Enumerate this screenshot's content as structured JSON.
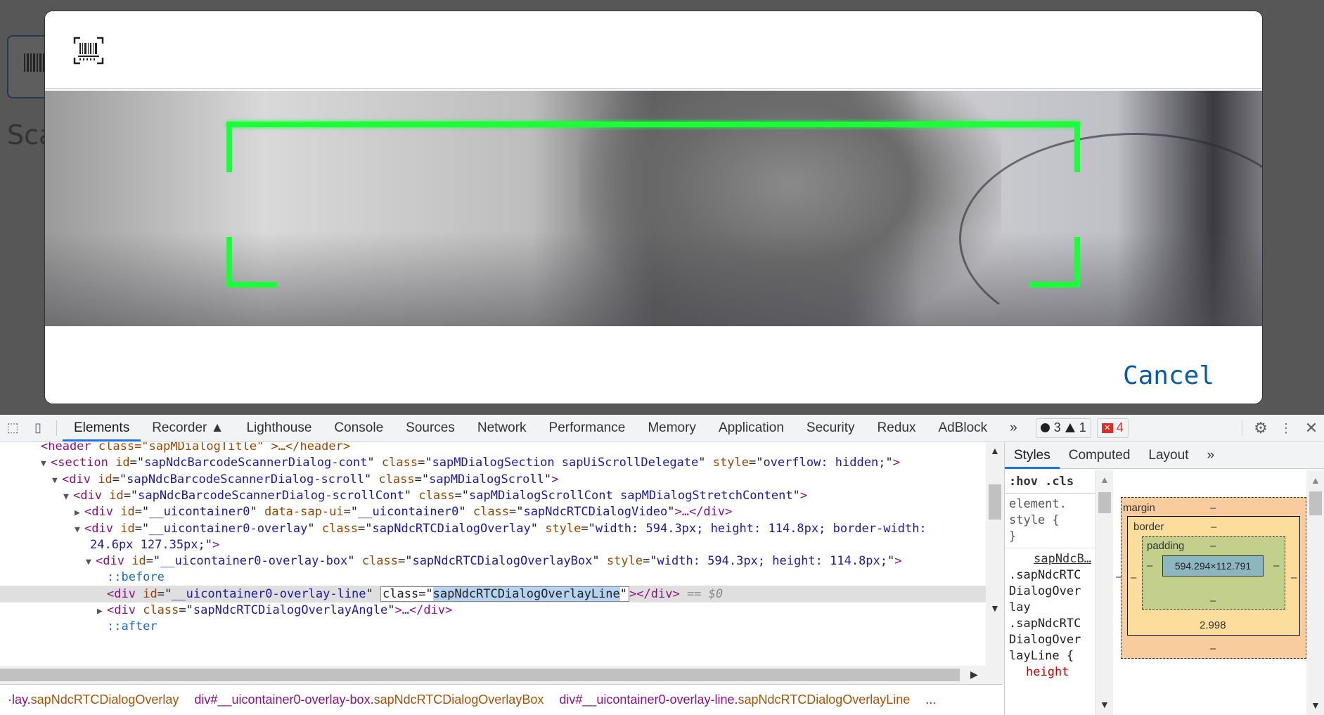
{
  "page": {
    "background_text": "Sca"
  },
  "dialog": {
    "cancel_label": "Cancel",
    "scan_icon": "barcode-scan-icon"
  },
  "devtools": {
    "tabs": [
      "Elements",
      "Recorder",
      "Lighthouse",
      "Console",
      "Sources",
      "Network",
      "Performance",
      "Memory",
      "Application",
      "Security",
      "Redux",
      "AdBlock"
    ],
    "more_tabs": "»",
    "errors_count": "3",
    "warnings_count": "1",
    "issues_count": "4",
    "elements": {
      "lines": [
        {
          "indent": 58,
          "open": "<",
          "tag": "header",
          "rest": " class=\"sapMDialogTitle\" >…</header>"
        },
        {
          "indent": 58,
          "twisty": "▼",
          "tag": "section",
          "attrs": [
            [
              "id",
              "sapNdcBarcodeScannerDialog-cont"
            ],
            [
              "class",
              "sapMDialogSection sapUiScrollDelegate"
            ],
            [
              "style",
              "overflow: hidden;"
            ]
          ],
          "close": ">"
        },
        {
          "indent": 74,
          "twisty": "▼",
          "tag": "div",
          "attrs": [
            [
              "id",
              "sapNdcBarcodeScannerDialog-scroll"
            ],
            [
              "class",
              "sapMDialogScroll"
            ]
          ],
          "close": ">"
        },
        {
          "indent": 90,
          "twisty": "▼",
          "tag": "div",
          "attrs": [
            [
              "id",
              "sapNdcBarcodeScannerDialog-scrollCont"
            ],
            [
              "class",
              "sapMDialogScrollCont sapMDialogStretchContent"
            ]
          ],
          "close": ">"
        },
        {
          "indent": 106,
          "twisty": "▶",
          "tag": "div",
          "attrs": [
            [
              "id",
              "__uicontainer0"
            ],
            [
              "data-sap-ui",
              "__uicontainer0"
            ],
            [
              "class",
              "sapNdcRTCDialogVideo"
            ]
          ],
          "close": ">…</div>"
        },
        {
          "indent": 106,
          "twisty": "▼",
          "tag": "div",
          "attrs": [
            [
              "id",
              "__uicontainer0-overlay"
            ],
            [
              "class",
              "sapNdcRTCDialogOverlay"
            ],
            [
              "style",
              "width: 594.3px; height: 114.8px; border-width: "
            ]
          ],
          "close": ""
        },
        {
          "indent": 128,
          "plain": "24.6px 127.35px;\">"
        },
        {
          "indent": 122,
          "twisty": "▼",
          "tag": "div",
          "attrs": [
            [
              "id",
              "__uicontainer0-overlay-box"
            ],
            [
              "class",
              "sapNdcRTCDialogOverlayBox"
            ],
            [
              "style",
              "width: 594.3px; height: 114.8px;"
            ]
          ],
          "close": ">"
        },
        {
          "indent": 152,
          "pseudo": "::before"
        },
        {
          "indent": 152,
          "selected": true
        },
        {
          "indent": 138,
          "twisty": "▶",
          "tag": "div",
          "attrs": [
            [
              "class",
              "sapNdcRTCDialogOverlayAngle"
            ]
          ],
          "close": ">…</div>"
        },
        {
          "indent": 152,
          "pseudo": "::after"
        }
      ],
      "selected_id": "__uicontainer0-overlay-line",
      "selected_class_attr": "class=\"",
      "selected_class_value": "sapNdcRTCDialogOverlayLine",
      "selected_tail": "\"></div>",
      "selected_dollar": "== $0"
    },
    "breadcrumbs": [
      {
        "tag": "·lay.",
        "cls": "sapNdcRTCDialogOverlay"
      },
      {
        "tag": "div#__uicontainer0-overlay-box.",
        "cls": "sapNdcRTCDialogOverlayBox"
      },
      {
        "tag": "div#__uicontainer0-overlay-line.",
        "cls": "sapNdcRTCDialogOverlayLine"
      },
      {
        "tag": "...",
        "cls": ""
      }
    ],
    "styles": {
      "tabs": [
        "Styles",
        "Computed",
        "Layout"
      ],
      "more": "»",
      "filter": ":hov  .cls",
      "element_style_line1": "element.",
      "element_style_line2": "style {",
      "element_style_close": "}",
      "rule_source": "sapNdcB…",
      "rule_selector_lines": [
        ".sapNdcRTC",
        "DialogOver",
        "lay",
        ".sapNdcRTC",
        "DialogOver",
        "layLine {"
      ],
      "rule_prop": "height",
      "rule_prop_tail": ":"
    },
    "box_model": {
      "margin_label": "margin",
      "margin_value": "–",
      "margin_bottom": "–",
      "border_label": "border",
      "border_value": "–",
      "border_bottom": "2.998",
      "padding_label": "padding",
      "padding_value": "–",
      "padding_bottom": "–",
      "content_size": "594.294×112.791",
      "side_dash": "–"
    }
  }
}
